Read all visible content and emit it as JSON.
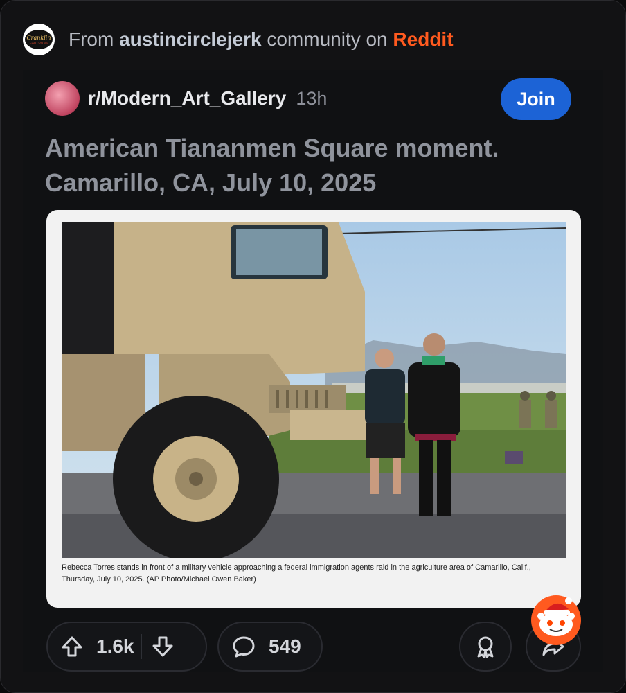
{
  "header": {
    "avatar_lines": [
      "Cranklin",
      "CARTOONS"
    ],
    "prefix": "From",
    "community": "austincirclejerk",
    "middle": "community on",
    "platform": "Reddit"
  },
  "post": {
    "subreddit": "r/Modern_Art_Gallery",
    "time": "13h",
    "join_label": "Join",
    "title_line1": "American Tiananmen Square moment.",
    "title_line2": "Camarillo, CA, July 10, 2025",
    "image_caption": "Rebecca Torres stands in front of a military vehicle approaching a federal immigration agents raid in the agriculture area of Camarillo, Calif., Thursday, July 10, 2025. (AP Photo/Michael Owen Baker)",
    "upvotes": "1.6k",
    "comments": "549"
  },
  "icons": {
    "upvote": "upvote-arrow-icon",
    "downvote": "downvote-arrow-icon",
    "comment": "comment-bubble-icon",
    "award": "award-ribbon-icon",
    "share": "share-arrow-icon",
    "mascot": "snoo-santa-icon"
  },
  "colors": {
    "background": "#121214",
    "reddit_orange": "#ff5a1f",
    "join_blue": "#1c63d6",
    "title_gray": "#8f939c"
  }
}
